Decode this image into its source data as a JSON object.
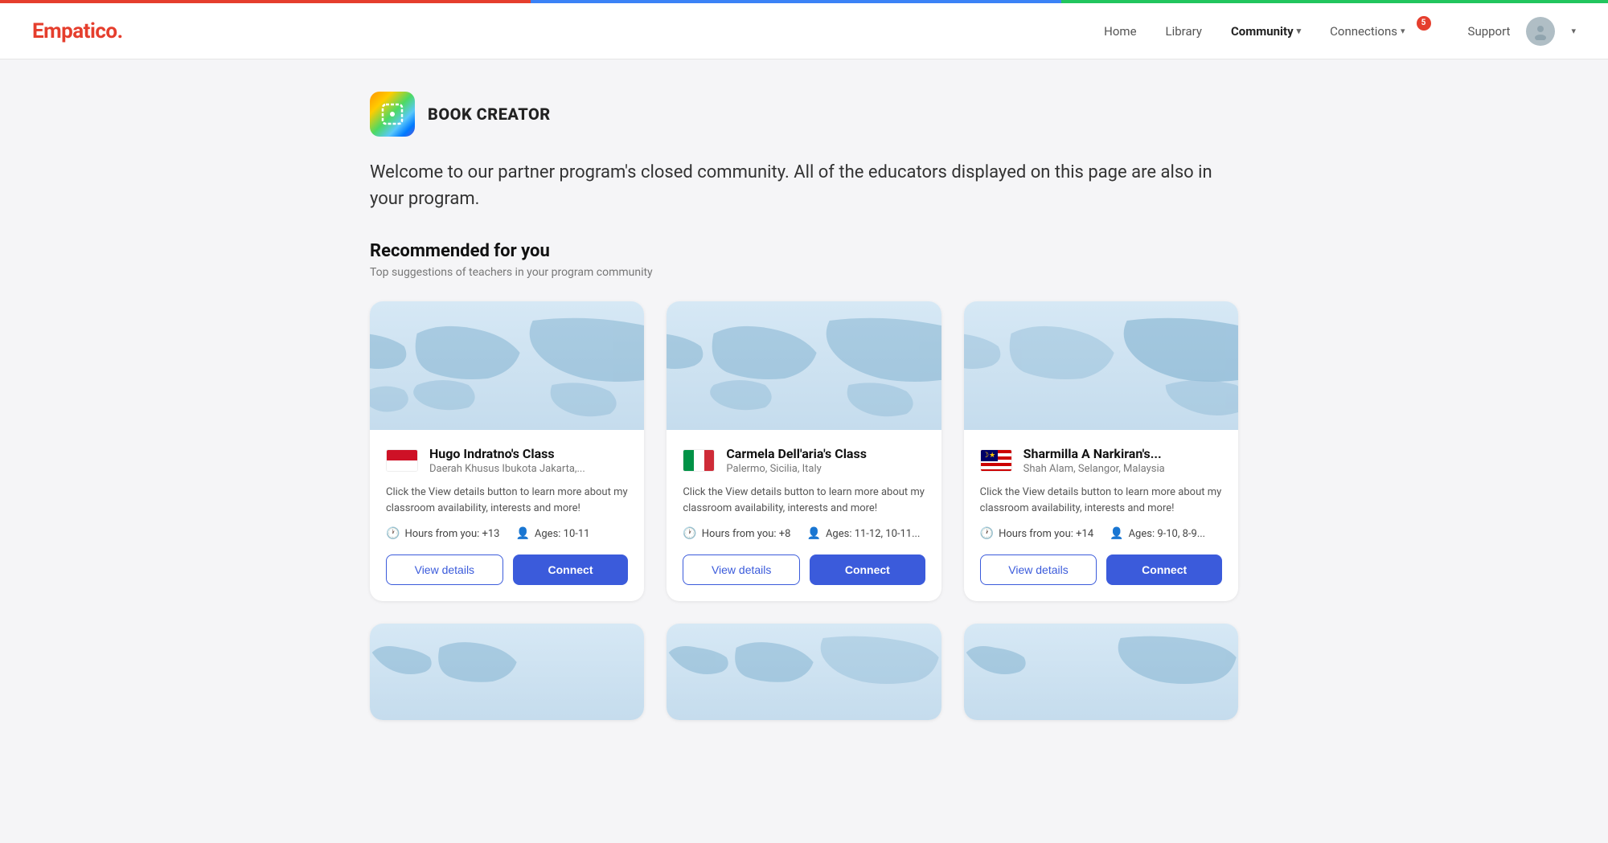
{
  "topBar": {
    "colors": [
      "#e53e2d",
      "#3b82f6",
      "#22c55e"
    ]
  },
  "header": {
    "logo": "Empatico.",
    "nav": [
      {
        "id": "home",
        "label": "Home",
        "active": false
      },
      {
        "id": "library",
        "label": "Library",
        "active": false
      },
      {
        "id": "community",
        "label": "Community",
        "active": true,
        "hasArrow": true
      },
      {
        "id": "connections",
        "label": "Connections",
        "active": false,
        "hasArrow": true,
        "badge": "5"
      }
    ],
    "support": "Support",
    "chevronLabel": "▾"
  },
  "partner": {
    "name": "BOOK CREATOR",
    "welcomeText": "Welcome to our partner program's closed community. All of the educators displayed on this page are also in your program."
  },
  "recommended": {
    "title": "Recommended for you",
    "subtitle": "Top suggestions of teachers in your program community"
  },
  "cards": [
    {
      "id": "hugo",
      "className": "Hugo Indratno's Class",
      "location": "Daerah Khusus Ibukota Jakarta,...",
      "description": "Click the View details button to learn more about my classroom availability, interests and more!",
      "hours": "Hours from you: +13",
      "ages": "Ages: 10-11",
      "flag": "indonesia",
      "viewLabel": "View details",
      "connectLabel": "Connect"
    },
    {
      "id": "carmela",
      "className": "Carmela Dell'aria's Class",
      "location": "Palermo, Sicilia, Italy",
      "description": "Click the View details button to learn more about my classroom availability, interests and more!",
      "hours": "Hours from you: +8",
      "ages": "Ages: 11-12, 10-11...",
      "flag": "italy",
      "viewLabel": "View details",
      "connectLabel": "Connect"
    },
    {
      "id": "sharmilla",
      "className": "Sharmilla A Narkiran's...",
      "location": "Shah Alam, Selangor, Malaysia",
      "description": "Click the View details button to learn more about my classroom availability, interests and more!",
      "hours": "Hours from you: +14",
      "ages": "Ages: 9-10, 8-9...",
      "flag": "malaysia",
      "viewLabel": "View details",
      "connectLabel": "Connect"
    }
  ],
  "partialCards": [
    {
      "id": "partial1"
    },
    {
      "id": "partial2"
    },
    {
      "id": "partial3"
    }
  ]
}
